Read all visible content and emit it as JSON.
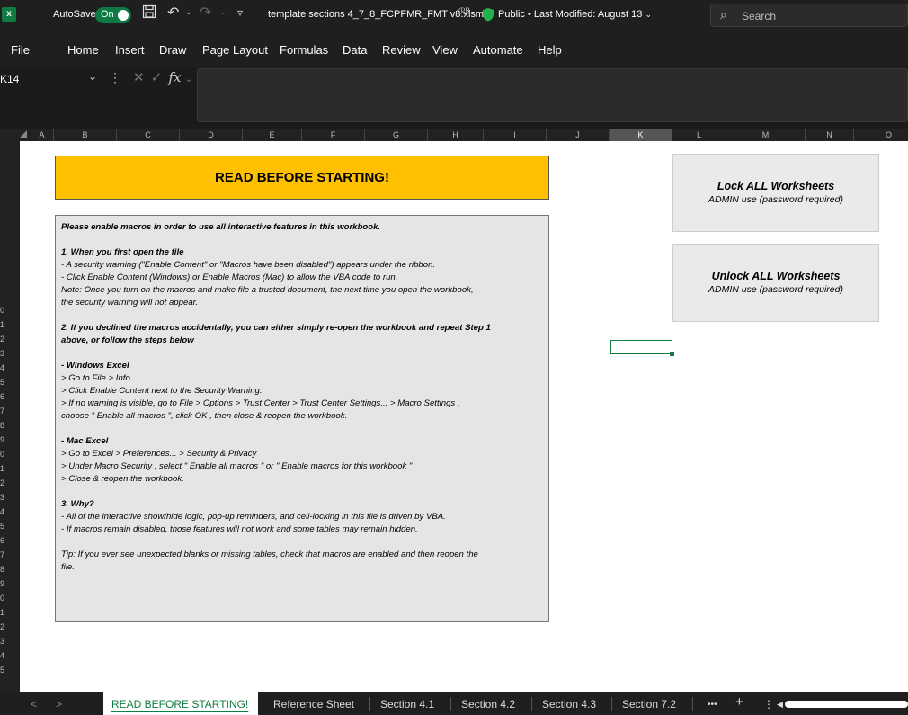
{
  "titlebar": {
    "app_icon": "x",
    "autosave_label": "AutoSave",
    "autosave_state": "On",
    "save_icon": "save-icon",
    "undo_icon": "↶",
    "redo_icon": "↷",
    "customize_icon": "▿",
    "doc_title": "template sections 4_7_8_FCPFMR_FMT v8.xlsm",
    "doc_status": "Public • Last Modified: August 13",
    "search_placeholder": "Search"
  },
  "menu": [
    "File",
    "Home",
    "Insert",
    "Draw",
    "Page Layout",
    "Formulas",
    "Data",
    "Review",
    "View",
    "Automate",
    "Help"
  ],
  "formula_bar": {
    "name_box": "K14",
    "fx": "fx"
  },
  "columns": [
    "A",
    "B",
    "C",
    "D",
    "E",
    "F",
    "G",
    "H",
    "I",
    "J",
    "K",
    "L",
    "M",
    "N",
    "O"
  ],
  "selected_column": "K",
  "rows": [
    "0",
    "1",
    "2",
    "3",
    "4",
    "5",
    "6",
    "7",
    "8",
    "9",
    "0",
    "1",
    "2",
    "3",
    "4",
    "5",
    "6",
    "7",
    "8",
    "9",
    "0",
    "1",
    "2",
    "3",
    "4",
    "5"
  ],
  "banner": "READ BEFORE STARTING!",
  "instructions": [
    {
      "t": "Please enable macros in order to use all interactive features in this workbook.",
      "b": true
    },
    {
      "t": ""
    },
    {
      "t": "1. When you first open the file",
      "b": true
    },
    {
      "t": "-  A security warning (\"Enable Content\" or \"Macros have been disabled\") appears under the ribbon."
    },
    {
      "t": "- Click  Enable Content  (Windows) or  Enable Macros  (Mac) to allow the VBA code to run."
    },
    {
      "t": "Note: Once you turn on the macros and make file a trusted document, the next time you open the workbook,"
    },
    {
      "t": "the security warning will not appear."
    },
    {
      "t": ""
    },
    {
      "t": "2. If you declined the macros accidentally, you can either simply re-open the workbook and repeat Step 1",
      "b": true
    },
    {
      "t": "above, or follow the steps below",
      "b": true
    },
    {
      "t": ""
    },
    {
      "t": "-  Windows Excel",
      "b": true
    },
    {
      "t": "  > Go to  File > Info"
    },
    {
      "t": "  > Click  Enable Content  next to the Security Warning."
    },
    {
      "t": "  > If no warning is visible, go to  File > Options > Trust Center > Trust Center Settings... > Macro Settings ,"
    },
    {
      "t": "choose \" Enable all macros \", click  OK , then close & reopen the workbook."
    },
    {
      "t": ""
    },
    {
      "t": "-  Mac Excel",
      "b": true
    },
    {
      "t": "  > Go to  Excel > Preferences... > Security & Privacy"
    },
    {
      "t": "  > Under  Macro Security , select \" Enable all macros \" or \" Enable macros for this workbook \""
    },
    {
      "t": "  > Close & reopen the workbook."
    },
    {
      "t": ""
    },
    {
      "t": "3. Why?",
      "b": true
    },
    {
      "t": "- All of the interactive show/hide logic, pop-up reminders, and cell-locking in this file is driven by VBA."
    },
    {
      "t": "- If macros remain disabled, those features will not work and some tables may remain hidden."
    },
    {
      "t": ""
    },
    {
      "t": "Tip: If you ever see unexpected blanks or missing tables, check that macros are enabled and then reopen the"
    },
    {
      "t": "file."
    }
  ],
  "lock_button": {
    "title": "Lock ALL Worksheets",
    "subtitle": "ADMIN use (password required)"
  },
  "unlock_button": {
    "title": "Unlock ALL Worksheets",
    "subtitle": "ADMIN use (password required)"
  },
  "tabs": [
    "READ BEFORE STARTING!",
    "Reference Sheet",
    "Section 4.1",
    "Section 4.2",
    "Section 4.3",
    "Section 7.2"
  ],
  "tab_controls": {
    "prev": "<",
    "next": ">",
    "more": "•••",
    "add": "+",
    "options": "⋮"
  }
}
